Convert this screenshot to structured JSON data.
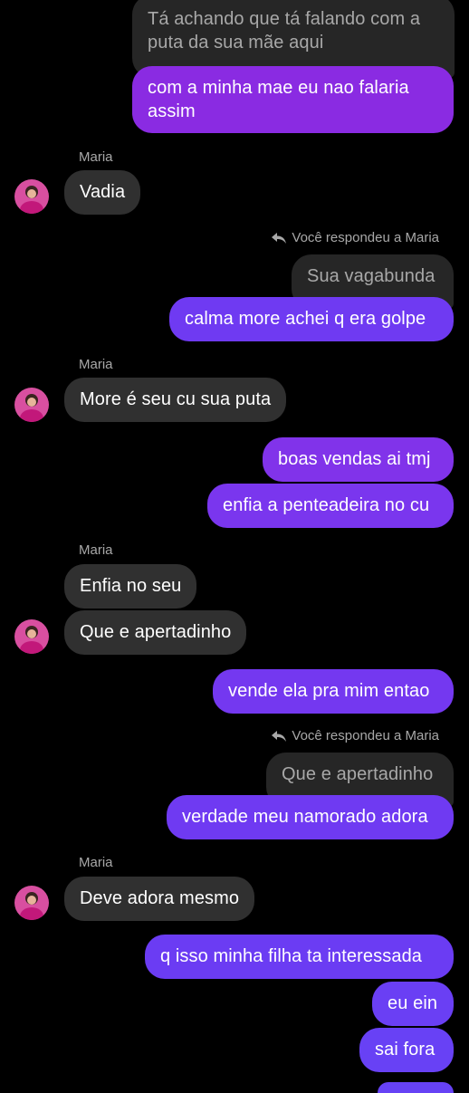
{
  "colors": {
    "background": "#000000",
    "incoming_bubble": "#303030",
    "quoted_bubble": "#262626",
    "outgoing_purple": "#8a2be2",
    "outgoing_violet": "#6f3af2",
    "secondary_text": "#a8a8a8"
  },
  "contact": {
    "name": "Maria",
    "avatar_icon": "profile-photo-avatar"
  },
  "reply_notice": {
    "icon": "reply-arrow-icon",
    "text": "Você respondeu a Maria"
  },
  "messages": [
    {
      "type": "quoted",
      "text": "Tá achando que tá falando com a puta da sua mãe aqui"
    },
    {
      "type": "out",
      "text": "com a minha mae eu nao falaria assim"
    },
    {
      "type": "sender",
      "text": "Maria"
    },
    {
      "type": "in",
      "text": "Vadia"
    },
    {
      "type": "reply_notice",
      "text": "Você respondeu a Maria"
    },
    {
      "type": "quoted",
      "text": "Sua vagabunda"
    },
    {
      "type": "out",
      "text": "calma more achei q era golpe"
    },
    {
      "type": "sender",
      "text": "Maria"
    },
    {
      "type": "in",
      "text": "More é seu cu sua puta"
    },
    {
      "type": "out",
      "text": "boas vendas ai tmj"
    },
    {
      "type": "out",
      "text": "enfia a penteadeira no cu"
    },
    {
      "type": "sender",
      "text": "Maria"
    },
    {
      "type": "in",
      "text": "Enfia no seu"
    },
    {
      "type": "in",
      "text": "Que e apertadinho"
    },
    {
      "type": "out",
      "text": "vende ela pra mim entao"
    },
    {
      "type": "reply_notice",
      "text": "Você respondeu a Maria"
    },
    {
      "type": "quoted",
      "text": "Que e apertadinho"
    },
    {
      "type": "out",
      "text": "verdade meu namorado adora"
    },
    {
      "type": "sender",
      "text": "Maria"
    },
    {
      "type": "in",
      "text": "Deve adora mesmo"
    },
    {
      "type": "out",
      "text": "q isso minha filha ta interessada"
    },
    {
      "type": "out",
      "text": "eu ein"
    },
    {
      "type": "out",
      "text": "sai fora"
    }
  ]
}
